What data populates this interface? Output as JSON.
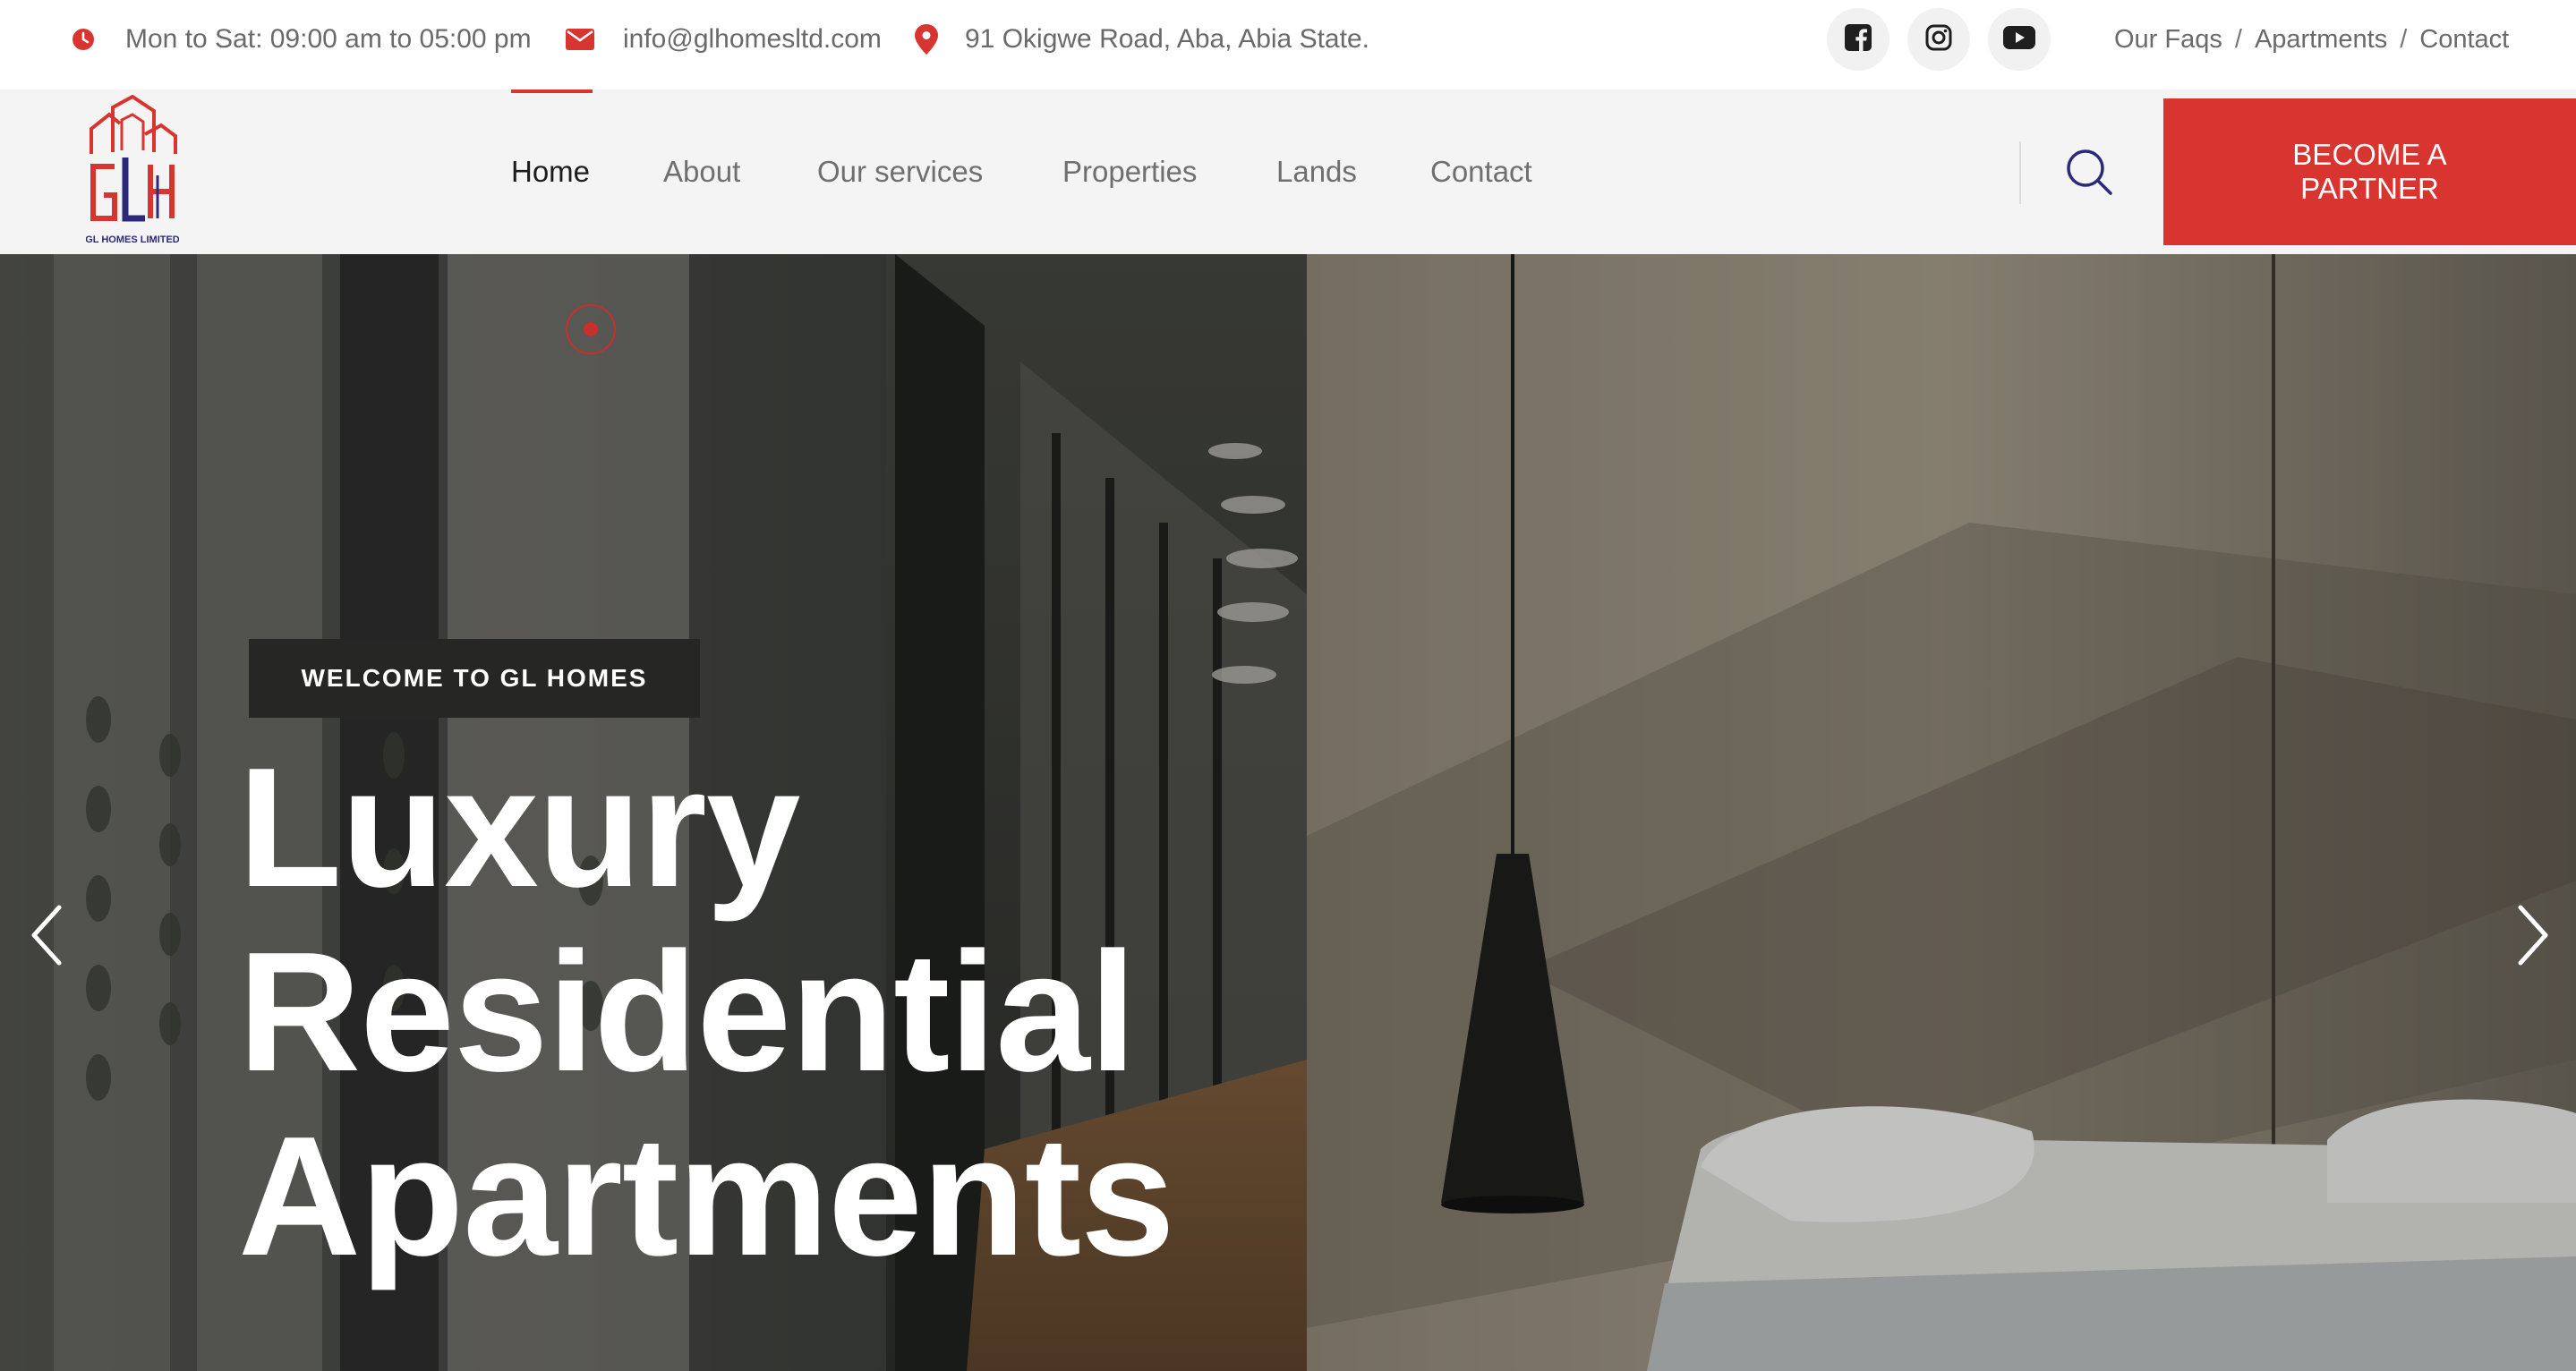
{
  "topbar": {
    "hours": "Mon to Sat: 09:00 am to 05:00 pm",
    "email": "info@glhomesltd.com",
    "address": "91 Okigwe Road, Aba, Abia State.",
    "social": [
      {
        "icon": "facebook-icon"
      },
      {
        "icon": "instagram-icon"
      },
      {
        "icon": "youtube-icon"
      }
    ],
    "links": [
      {
        "label": "Our Faqs"
      },
      {
        "label": "Apartments"
      },
      {
        "label": "Contact"
      }
    ],
    "separator": "/"
  },
  "brand": {
    "logo_text": "GL HOMES LIMITED",
    "logo_letters": "GLH",
    "primary_color": "#d93530",
    "secondary_color": "#2b2a7a"
  },
  "nav": {
    "items": [
      {
        "label": "Home",
        "active": true
      },
      {
        "label": "About"
      },
      {
        "label": "Our services"
      },
      {
        "label": "Properties"
      },
      {
        "label": "Lands"
      },
      {
        "label": "Contact"
      }
    ],
    "cta_line1": "BECOME A",
    "cta_line2": "PARTNER"
  },
  "hero": {
    "tagline": "WELCOME TO GL HOMES",
    "headline_lines": [
      "Luxury",
      "Residential",
      "Apartments"
    ],
    "icons": {
      "prev": "chevron-left-icon",
      "next": "chevron-right-icon",
      "indicator": "slide-dot-icon"
    }
  }
}
